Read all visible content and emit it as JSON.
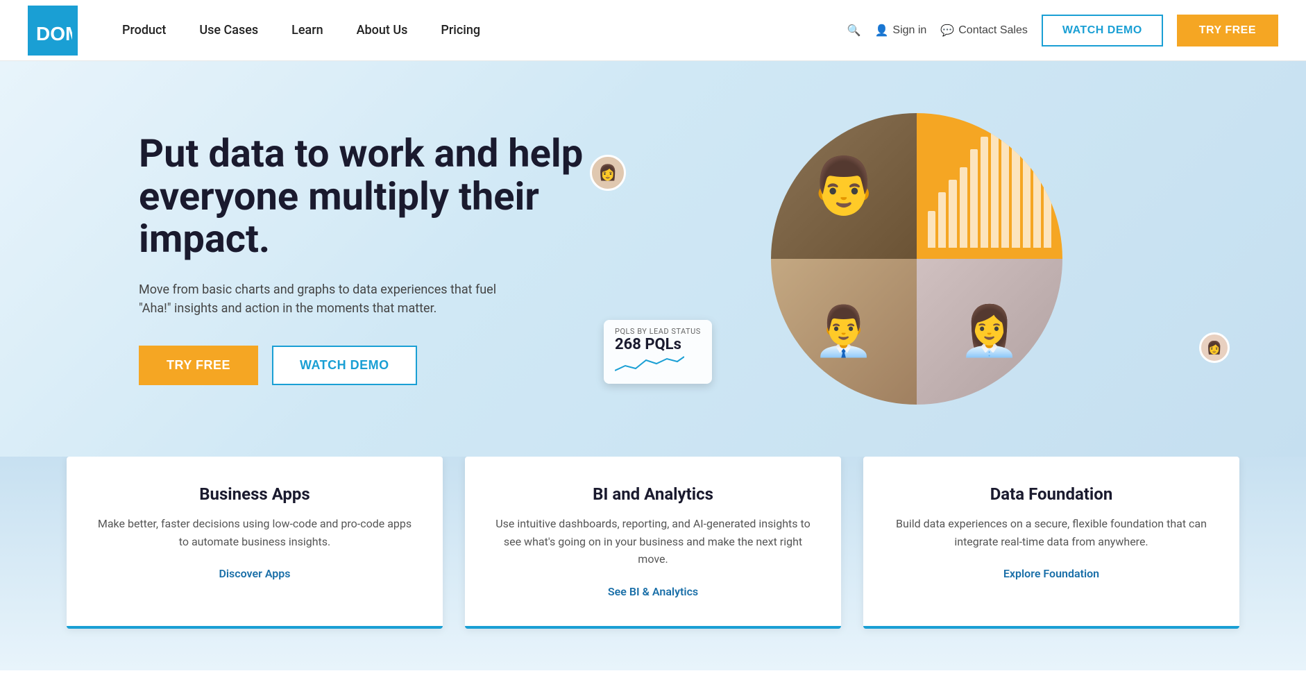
{
  "brand": {
    "name": "DOMO",
    "logo_color": "#1a9fd4"
  },
  "navbar": {
    "nav_links": [
      {
        "id": "product",
        "label": "Product"
      },
      {
        "id": "use-cases",
        "label": "Use Cases"
      },
      {
        "id": "learn",
        "label": "Learn"
      },
      {
        "id": "about-us",
        "label": "About Us"
      },
      {
        "id": "pricing",
        "label": "Pricing"
      }
    ],
    "search_label": "🔍",
    "sign_in_label": "Sign in",
    "contact_sales_label": "Contact Sales",
    "watch_demo_label": "WATCH DEMO",
    "try_free_label": "TRY FREE"
  },
  "hero": {
    "title": "Put data to work and help everyone multiply their impact.",
    "subtitle": "Move from basic charts and graphs to data experiences that fuel \"Aha!\" insights and action in the moments that matter.",
    "cta_try_free": "TRY FREE",
    "cta_watch_demo": "WATCH DEMO",
    "stats_label": "PQLS BY LEAD STATUS",
    "stats_value": "268 PQLs"
  },
  "cards": [
    {
      "id": "business-apps",
      "title": "Business Apps",
      "description": "Make better, faster decisions using low-code and pro-code apps to automate business insights.",
      "link_label": "Discover Apps"
    },
    {
      "id": "bi-analytics",
      "title": "BI and Analytics",
      "description": "Use intuitive dashboards, reporting, and AI-generated insights to see what's going on in your business and make the next right move.",
      "link_label": "See BI & Analytics"
    },
    {
      "id": "data-foundation",
      "title": "Data Foundation",
      "description": "Build data experiences on a secure, flexible foundation that can integrate real-time data from anywhere.",
      "link_label": "Explore Foundation"
    }
  ],
  "chart_bars": [
    30,
    45,
    55,
    65,
    80,
    90,
    100,
    95,
    85,
    75,
    88,
    92
  ],
  "accent_color": "#f5a623",
  "primary_color": "#1a9fd4"
}
